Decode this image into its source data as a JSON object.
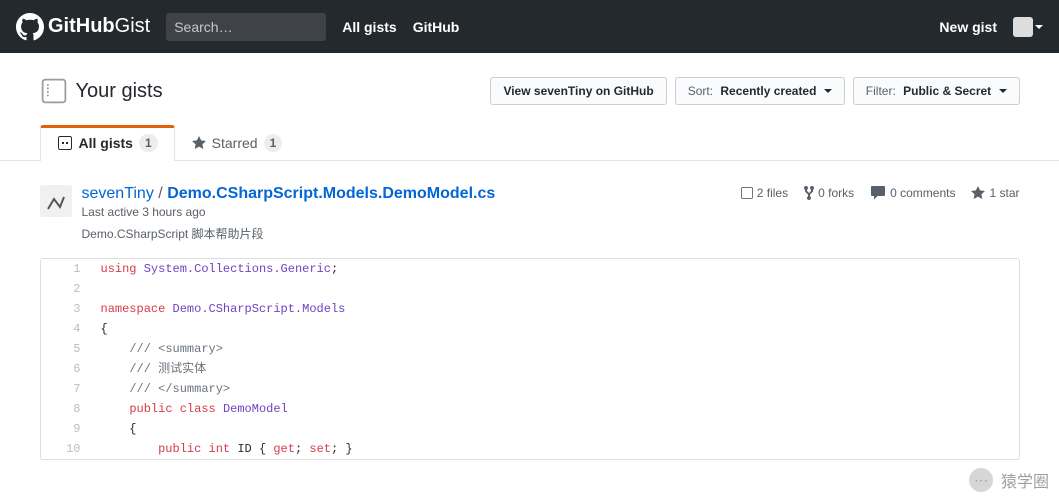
{
  "header": {
    "logo_bold": "GitHub",
    "logo_light": "Gist",
    "search_placeholder": "Search…",
    "nav": {
      "all_gists": "All gists",
      "github": "GitHub"
    },
    "new_gist": "New gist"
  },
  "subhead": {
    "title": "Your gists",
    "buttons": {
      "view_profile": "View sevenTiny on GitHub",
      "sort_label": "Sort:",
      "sort_value": "Recently created",
      "filter_label": "Filter:",
      "filter_value": "Public & Secret"
    }
  },
  "tabs": {
    "all_gists": {
      "label": "All gists",
      "count": "1"
    },
    "starred": {
      "label": "Starred",
      "count": "1"
    }
  },
  "gist": {
    "owner": "sevenTiny",
    "sep": "/",
    "filename": "Demo.CSharpScript.Models.DemoModel.cs",
    "meta": "Last active 3 hours ago",
    "description": "Demo.CSharpScript 脚本帮助片段",
    "stats": {
      "files": "2 files",
      "forks": "0 forks",
      "comments": "0 comments",
      "stars": "1 star"
    }
  },
  "code": {
    "lines": [
      {
        "n": "1",
        "html": "<span class='k'>using</span> <span class='nn'>System.Collections.Generic</span>;"
      },
      {
        "n": "2",
        "html": ""
      },
      {
        "n": "3",
        "html": "<span class='k'>namespace</span> <span class='nn'>Demo.CSharpScript.Models</span>"
      },
      {
        "n": "4",
        "html": "{"
      },
      {
        "n": "5",
        "html": "    <span class='c'>/// &lt;summary&gt;</span>"
      },
      {
        "n": "6",
        "html": "    <span class='c'>/// 测试实体</span>"
      },
      {
        "n": "7",
        "html": "    <span class='c'>/// &lt;/summary&gt;</span>"
      },
      {
        "n": "8",
        "html": "    <span class='k'>public</span> <span class='k'>class</span> <span class='nc'>DemoModel</span>"
      },
      {
        "n": "9",
        "html": "    {"
      },
      {
        "n": "10",
        "html": "        <span class='k'>public</span> <span class='kt'>int</span> ID { <span class='k'>get</span>; <span class='k'>set</span>; }"
      }
    ]
  },
  "watermark": {
    "text": "猿学圈"
  }
}
